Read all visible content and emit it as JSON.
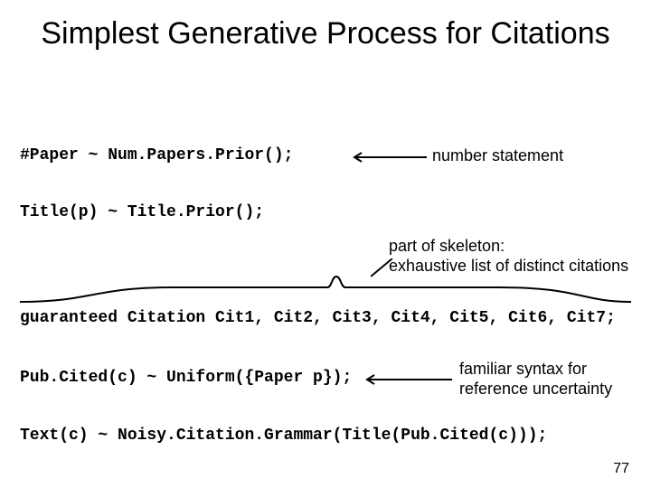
{
  "title": "Simplest Generative Process for Citations",
  "lines": {
    "paper": "#Paper ~ Num.Papers.Prior();",
    "titlep": "Title(p) ~ Title.Prior();",
    "guaranteed": "guaranteed Citation Cit1, Cit2, Cit3, Cit4, Cit5, Cit6, Cit7;",
    "pub": "Pub.Cited(c) ~ Uniform({Paper p});",
    "text": "Text(c) ~ Noisy.Citation.Grammar(Title(Pub.Cited(c)));"
  },
  "labels": {
    "number_stmt": "number statement",
    "skeleton_l1": "part of skeleton:",
    "skeleton_l2": "exhaustive list of distinct citations",
    "familiar_l1": "familiar syntax for",
    "familiar_l2": "reference uncertainty"
  },
  "page_number": "77"
}
